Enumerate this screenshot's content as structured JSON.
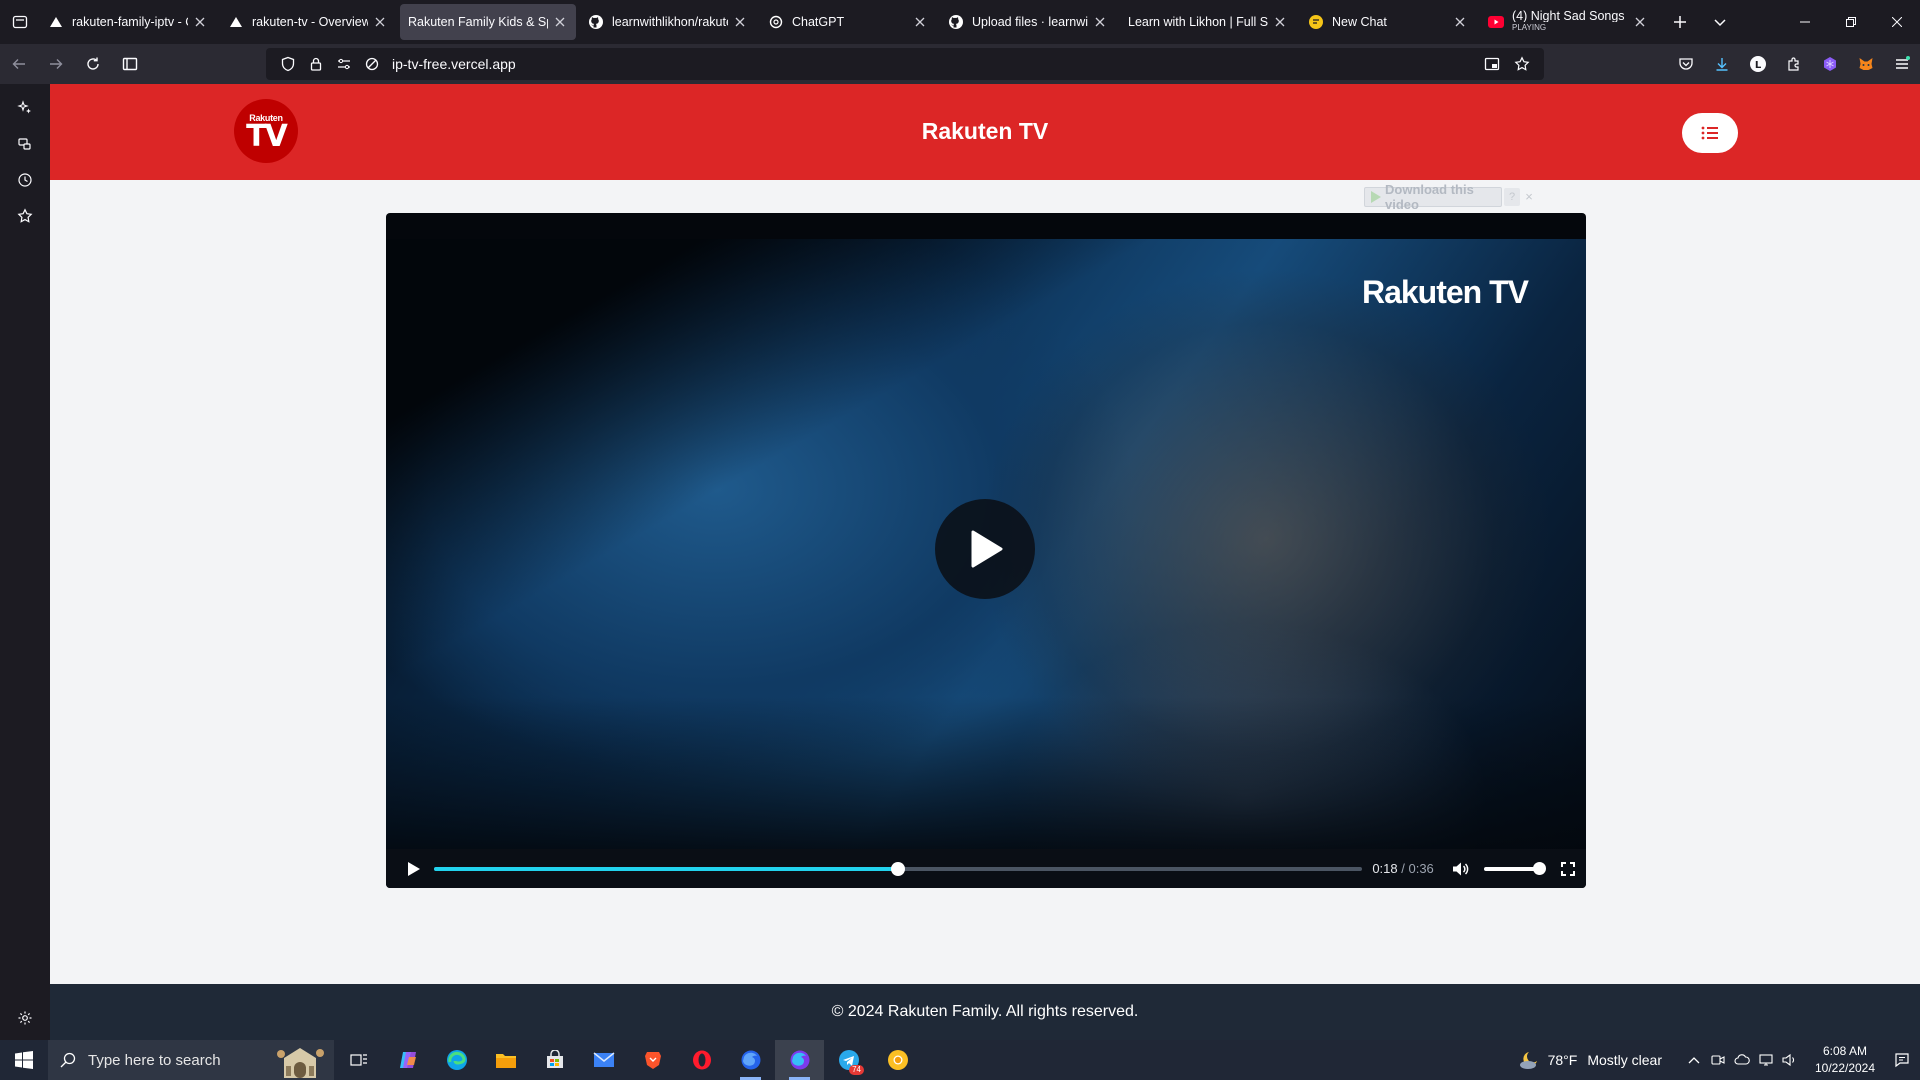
{
  "browser": {
    "tabs": [
      {
        "title": "rakuten-family-iptv - C",
        "icon": "vercel-icon",
        "active": false
      },
      {
        "title": "rakuten-tv - Overview",
        "icon": "vercel-icon",
        "active": false
      },
      {
        "title": "Rakuten Family Kids & Spo",
        "icon": "none",
        "active": true
      },
      {
        "title": "learnwithlikhon/rakute",
        "icon": "github-icon",
        "active": false
      },
      {
        "title": "ChatGPT",
        "icon": "chatgpt-icon",
        "active": false
      },
      {
        "title": "Upload files · learnwith",
        "icon": "github-icon",
        "active": false
      },
      {
        "title": "Learn with Likhon | Full Sta",
        "icon": "none",
        "active": false
      },
      {
        "title": "New Chat",
        "icon": "chat-icon",
        "active": false
      },
      {
        "title": "(4) Night Sad Songs",
        "subtitle": "PLAYING",
        "icon": "youtube-icon",
        "active": false
      }
    ],
    "url": "ip-tv-free.vercel.app"
  },
  "site": {
    "logo_top": "Rakuten",
    "logo_main": "TV",
    "title": "Rakuten TV",
    "download_label": "Download this video",
    "download_help": "?",
    "download_close": "×",
    "watermark": "Rakuten TV",
    "footer": "© 2024 Rakuten Family. All rights reserved."
  },
  "player": {
    "current_time": "0:18",
    "separator": " / ",
    "duration": "0:36",
    "progress_fraction": 0.5,
    "volume_fraction": 1.0,
    "accent_color": "#22d3ee"
  },
  "taskbar": {
    "search_placeholder": "Type here to search",
    "mail_badge": "74",
    "weather_temp": "78°F",
    "weather_condition": "Mostly clear",
    "time": "6:08 AM",
    "date": "10/22/2024"
  },
  "colors": {
    "header_red": "#dc2626",
    "footer_dark": "#1f2937",
    "page_bg": "#f3f4f6"
  }
}
